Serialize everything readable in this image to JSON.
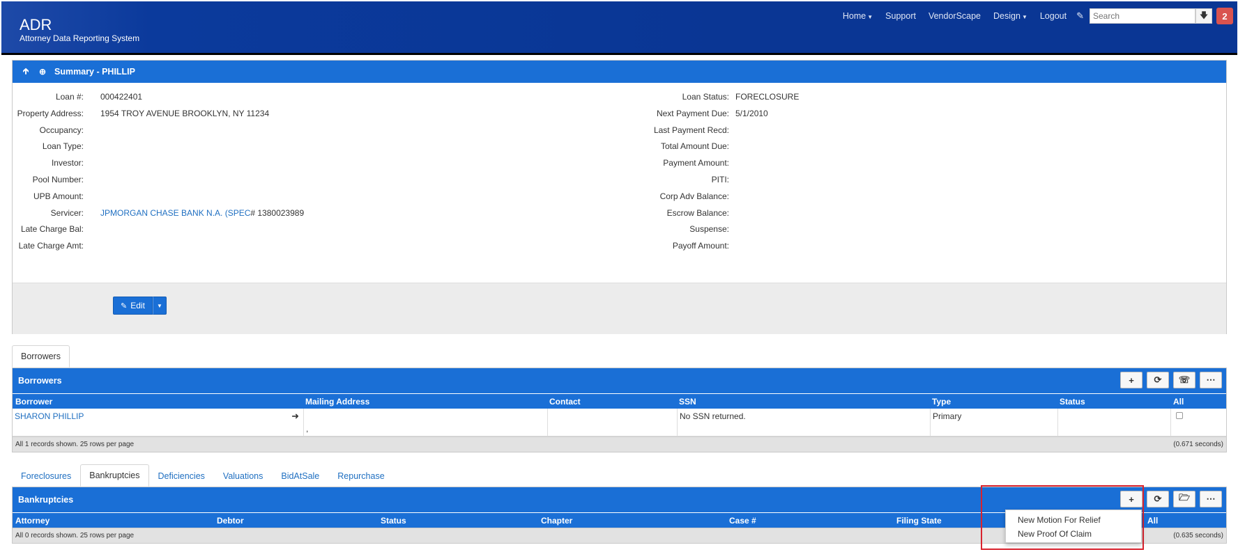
{
  "brand": {
    "title": "ADR",
    "subtitle": "Attorney Data Reporting System"
  },
  "nav": {
    "home": "Home",
    "support": "Support",
    "vendorscape": "VendorScape",
    "design": "Design",
    "logout": "Logout",
    "search_placeholder": "Search",
    "notification_count": "2"
  },
  "summary": {
    "title": "Summary - PHILLIP",
    "left_fields": [
      {
        "label": "Loan #:",
        "value": "000422401"
      },
      {
        "label": "Property Address:",
        "value": "1954 TROY AVENUE BROOKLYN, NY 11234"
      },
      {
        "label": "Occupancy:",
        "value": ""
      },
      {
        "label": "Loan Type:",
        "value": ""
      },
      {
        "label": "Investor:",
        "value": ""
      },
      {
        "label": "Pool Number:",
        "value": ""
      },
      {
        "label": "UPB Amount:",
        "value": ""
      },
      {
        "label": "Servicer:",
        "value": "JPMORGAN CHASE BANK N.A. (SPEC",
        "value_suffix": "# 1380023989"
      },
      {
        "label": "Late Charge Bal:",
        "value": ""
      },
      {
        "label": "Late Charge Amt:",
        "value": ""
      }
    ],
    "right_fields": [
      {
        "label": "Loan Status:",
        "value": "FORECLOSURE"
      },
      {
        "label": "Next Payment Due:",
        "value": "5/1/2010"
      },
      {
        "label": "Last Payment Recd:",
        "value": ""
      },
      {
        "label": "Total Amount Due:",
        "value": ""
      },
      {
        "label": "Payment Amount:",
        "value": ""
      },
      {
        "label": "PITI:",
        "value": ""
      },
      {
        "label": "Corp Adv Balance:",
        "value": ""
      },
      {
        "label": "Escrow Balance:",
        "value": ""
      },
      {
        "label": "Suspense:",
        "value": ""
      },
      {
        "label": "Payoff Amount:",
        "value": ""
      }
    ],
    "edit_label": "Edit"
  },
  "borrower_tabs": [
    "Borrowers"
  ],
  "borrowers": {
    "title": "Borrowers",
    "columns": [
      "Borrower",
      "Mailing Address",
      "Contact",
      "SSN",
      "Type",
      "Status",
      "All"
    ],
    "rows": [
      {
        "borrower": "SHARON PHILLIP",
        "mailing": ",",
        "contact": "",
        "ssn": "No SSN returned.",
        "type": "Primary",
        "status": ""
      }
    ],
    "footer_left": "All 1 records shown. 25 rows per page",
    "footer_right": "(0.671 seconds)"
  },
  "case_tabs": [
    "Foreclosures",
    "Bankruptcies",
    "Deficiencies",
    "Valuations",
    "BidAtSale",
    "Repurchase"
  ],
  "active_case_tab": "Bankruptcies",
  "bankruptcies": {
    "title": "Bankruptcies",
    "columns": [
      "Attorney",
      "Debtor",
      "Status",
      "Chapter",
      "Case #",
      "Filing State",
      "All"
    ],
    "footer_left": "All 0 records shown. 25 rows per page",
    "footer_right": "(0.635 seconds)",
    "menu_items": [
      "New Motion For Relief",
      "New Proof Of Claim"
    ]
  },
  "colors": {
    "header_blue": "#0a3694",
    "panel_blue": "#1a6fd6",
    "highlight_red": "#d9232e"
  }
}
